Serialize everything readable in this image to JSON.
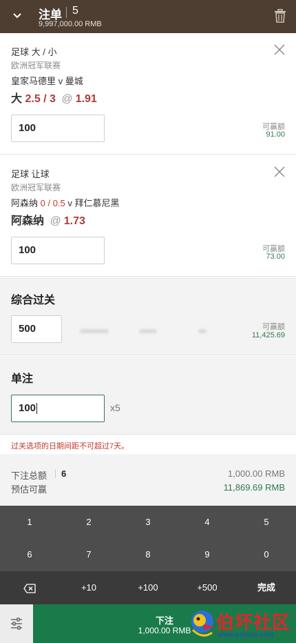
{
  "header": {
    "title": "注单",
    "count": "5",
    "balance": "9,997,000.00 RMB"
  },
  "bets": [
    {
      "market": "足球 大 / 小",
      "league": "欧洲冠军联赛",
      "match_home": "皇家马德里",
      "match_vs": " v ",
      "match_away": "曼城",
      "selection": "大",
      "line": "2.5 / 3",
      "at": "@",
      "odds": "1.91",
      "stake": "100",
      "to_win_label": "可赢额",
      "to_win": "91.00"
    },
    {
      "market": "足球 让球",
      "league": "欧洲冠军联赛",
      "match_home": "阿森纳",
      "match_hcp": " 0 / 0.5",
      "match_vs": " v ",
      "match_away": "拜仁慕尼黑",
      "selection": "阿森纳",
      "at": "@",
      "odds": "1.73",
      "stake": "100",
      "to_win_label": "可赢额",
      "to_win": "73.00"
    }
  ],
  "parlay": {
    "title": "综合过关",
    "stake": "500",
    "to_win_label": "可赢额",
    "to_win": "11,425.69"
  },
  "singles": {
    "title": "单注",
    "stake": "100",
    "multiplier": "x5"
  },
  "warning": "过关选项的日期间距不可超过7天。",
  "summary": {
    "total_label": "下注总额",
    "total_count": "6",
    "total_amount": "1,000.00 RMB",
    "est_label": "预估可赢",
    "est_amount": "11,869.69 RMB"
  },
  "keypad": {
    "row1": [
      "1",
      "2",
      "3",
      "4",
      "5"
    ],
    "row2": [
      "6",
      "7",
      "8",
      "9",
      "0"
    ],
    "row3": [
      "+10",
      "+100",
      "+500",
      "完成"
    ]
  },
  "footer": {
    "place_label": "下注",
    "place_amount": "1,000.00 RMB"
  },
  "watermark": {
    "text": "伯坏社区",
    "url": "www.pahuai.com"
  },
  "colors": {
    "header_bg": "#4e3e32",
    "odds_red": "#b03a3a",
    "win_green": "#2f7a4d",
    "place_button": "#1a7a4a",
    "keypad_bg": "#4d4d4d"
  },
  "icons": {
    "collapse": "chevron-down-icon",
    "delete_all": "trash-icon",
    "remove_bet": "close-icon",
    "backspace": "backspace-icon",
    "settings": "sliders-icon"
  }
}
